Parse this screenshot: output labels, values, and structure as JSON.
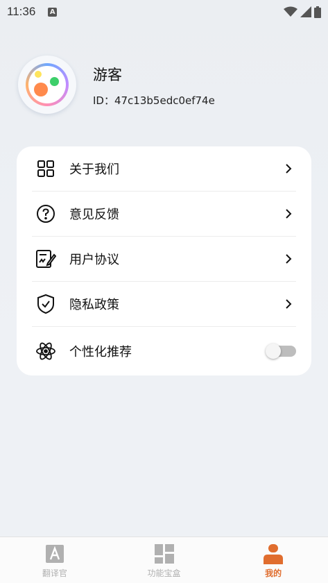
{
  "status_bar": {
    "time": "11:36",
    "notification_letter": "A"
  },
  "profile": {
    "name": "游客",
    "id_text": "ID：47c13b5edc0ef74e"
  },
  "menu": {
    "items": [
      {
        "label": "关于我们",
        "icon": "grid-icon"
      },
      {
        "label": "意见反馈",
        "icon": "question-circle-icon"
      },
      {
        "label": "用户协议",
        "icon": "agreement-document-icon"
      },
      {
        "label": "隐私政策",
        "icon": "shield-check-icon"
      }
    ],
    "personalized": {
      "label": "个性化推荐",
      "icon": "atom-icon",
      "enabled": false
    }
  },
  "bottom_nav": {
    "items": [
      {
        "label": "翻译官",
        "icon": "translate-a-icon",
        "active": false
      },
      {
        "label": "功能宝盒",
        "icon": "tiles-icon",
        "active": false
      },
      {
        "label": "我的",
        "icon": "person-icon",
        "active": true
      }
    ]
  },
  "colors": {
    "accent": "#e06d2e",
    "inactive": "#b0b0b0",
    "card": "#ffffff",
    "background": "#eef1f5"
  }
}
